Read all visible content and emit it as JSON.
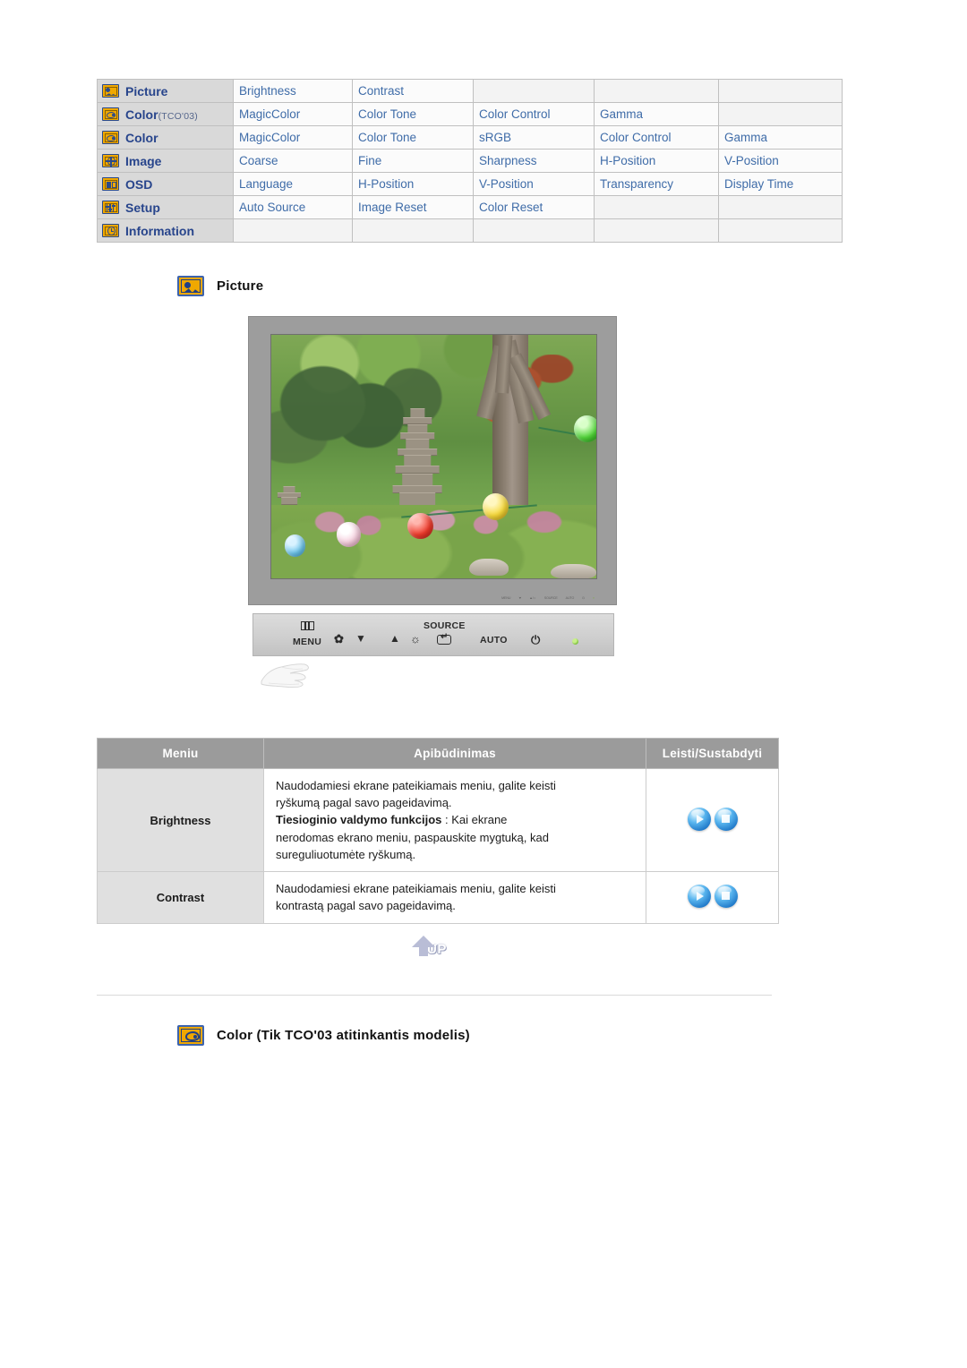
{
  "menu_map": {
    "rows": [
      {
        "icon": "picture-icon",
        "label": "Picture",
        "sub": "",
        "items": [
          "Brightness",
          "Contrast",
          "",
          "",
          ""
        ]
      },
      {
        "icon": "color-icon",
        "label": "Color",
        "sub": "(TCO'03)",
        "items": [
          "MagicColor",
          "Color Tone",
          "Color Control",
          "Gamma",
          ""
        ]
      },
      {
        "icon": "color-icon",
        "label": "Color",
        "sub": "",
        "items": [
          "MagicColor",
          "Color Tone",
          "sRGB",
          "Color Control",
          "Gamma"
        ]
      },
      {
        "icon": "image-icon",
        "label": "Image",
        "sub": "",
        "items": [
          "Coarse",
          "Fine",
          "Sharpness",
          "H-Position",
          "V-Position"
        ]
      },
      {
        "icon": "osd-icon",
        "label": "OSD",
        "sub": "",
        "items": [
          "Language",
          "H-Position",
          "V-Position",
          "Transparency",
          "Display Time"
        ]
      },
      {
        "icon": "setup-icon",
        "label": "Setup",
        "sub": "",
        "items": [
          "Auto Source",
          "Image Reset",
          "Color Reset",
          "",
          ""
        ]
      },
      {
        "icon": "information-icon",
        "label": "Information",
        "sub": "",
        "items": [
          "",
          "",
          "",
          "",
          ""
        ]
      }
    ]
  },
  "picture_section": {
    "heading": "Picture"
  },
  "monitor": {
    "controls": [
      {
        "name": "menu-button",
        "glyph": "menu-bars",
        "label": "MENU"
      },
      {
        "name": "magic-bright-button",
        "glyph": "✿",
        "label": ""
      },
      {
        "name": "down-button",
        "glyph": "▼",
        "label": ""
      },
      {
        "name": "up-button",
        "glyph": "▲",
        "label": ""
      },
      {
        "name": "brightness-button",
        "glyph": "☼",
        "label": ""
      },
      {
        "name": "source-button",
        "glyph": "source-box",
        "label": "SOURCE"
      },
      {
        "name": "auto-button",
        "glyph": "",
        "label": "AUTO"
      },
      {
        "name": "power-button",
        "glyph": "⏻",
        "label": ""
      },
      {
        "name": "power-indicator",
        "glyph": "led",
        "label": ""
      }
    ],
    "bezel_mini_labels": [
      "MENU",
      "⮟",
      "▲/☼",
      "SOURCE",
      "AUTO",
      "⏻",
      "●"
    ]
  },
  "desc_table": {
    "headers": [
      "Meniu",
      "Apibūdinimas",
      "Leisti/Sustabdyti"
    ],
    "rows": [
      {
        "menu": "Brightness",
        "description_line1": "Naudodamiesi ekrane pateikiamais meniu, galite keisti",
        "description_line2": "ryškumą pagal savo pageidavimą.",
        "description_bold": "Tiesioginio valdymo funkcijos",
        "description_line3": " : Kai ekrane",
        "description_line4": "nerodomas ekrano meniu, paspauskite mygtuką, kad",
        "description_line5": "sureguliuotumėte ryškumą.",
        "buttons": [
          "play-button",
          "stop-button"
        ]
      },
      {
        "menu": "Contrast",
        "description_line1": "Naudodamiesi ekrane pateikiamais meniu, galite keisti",
        "description_line2": "kontrastą pagal savo pageidavimą.",
        "description_bold": "",
        "description_line3": "",
        "description_line4": "",
        "description_line5": "",
        "buttons": [
          "play-button",
          "stop-button"
        ]
      }
    ]
  },
  "up_button": {
    "label": "UP"
  },
  "color_section": {
    "heading": "Color (Tik TCO'03 atitinkantis modelis)"
  },
  "colors": {
    "menu_label_text": "#28458c",
    "menu_item_text": "#3f6ca8",
    "label_cell_bg": "#d9d9d9",
    "header_bg": "#9b9b9b",
    "icon_fill": "#f0a800",
    "icon_border": "#2a4a8c",
    "button_blue": "#1f78c8"
  }
}
